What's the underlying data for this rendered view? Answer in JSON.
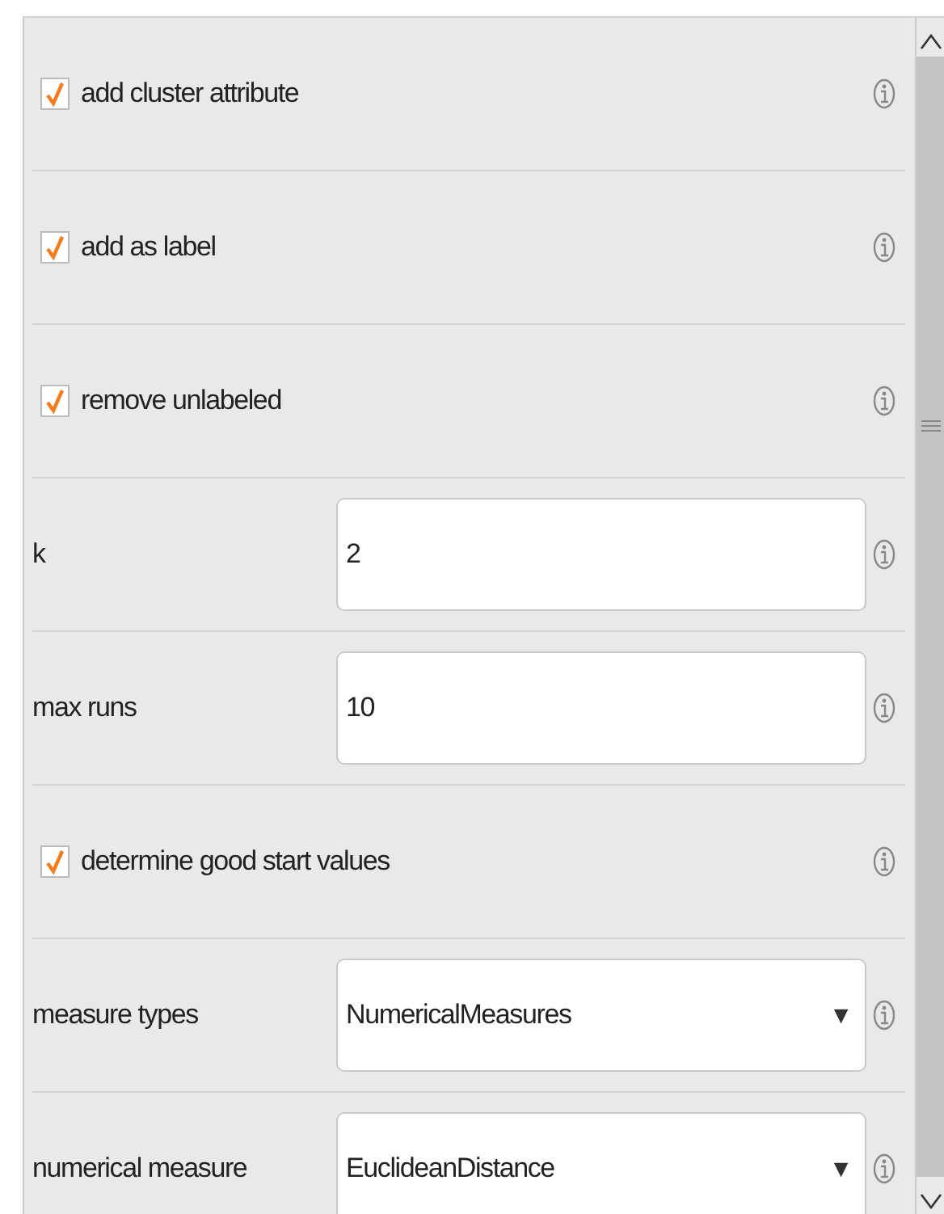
{
  "parameters": [
    {
      "kind": "checkbox",
      "label": "add cluster attribute",
      "checked": true
    },
    {
      "kind": "checkbox",
      "label": "add as label",
      "checked": true
    },
    {
      "kind": "checkbox",
      "label": "remove unlabeled",
      "checked": true
    },
    {
      "kind": "text",
      "label": "k",
      "value": "2"
    },
    {
      "kind": "text",
      "label": "max runs",
      "value": "10"
    },
    {
      "kind": "checkbox",
      "label": "determine good start values",
      "checked": true
    },
    {
      "kind": "select",
      "label": "measure types",
      "value": "NumericalMeasures",
      "arrow": "▼"
    },
    {
      "kind": "select",
      "label": "numerical measure",
      "value": "EuclideanDistance",
      "arrow": "▼"
    }
  ]
}
